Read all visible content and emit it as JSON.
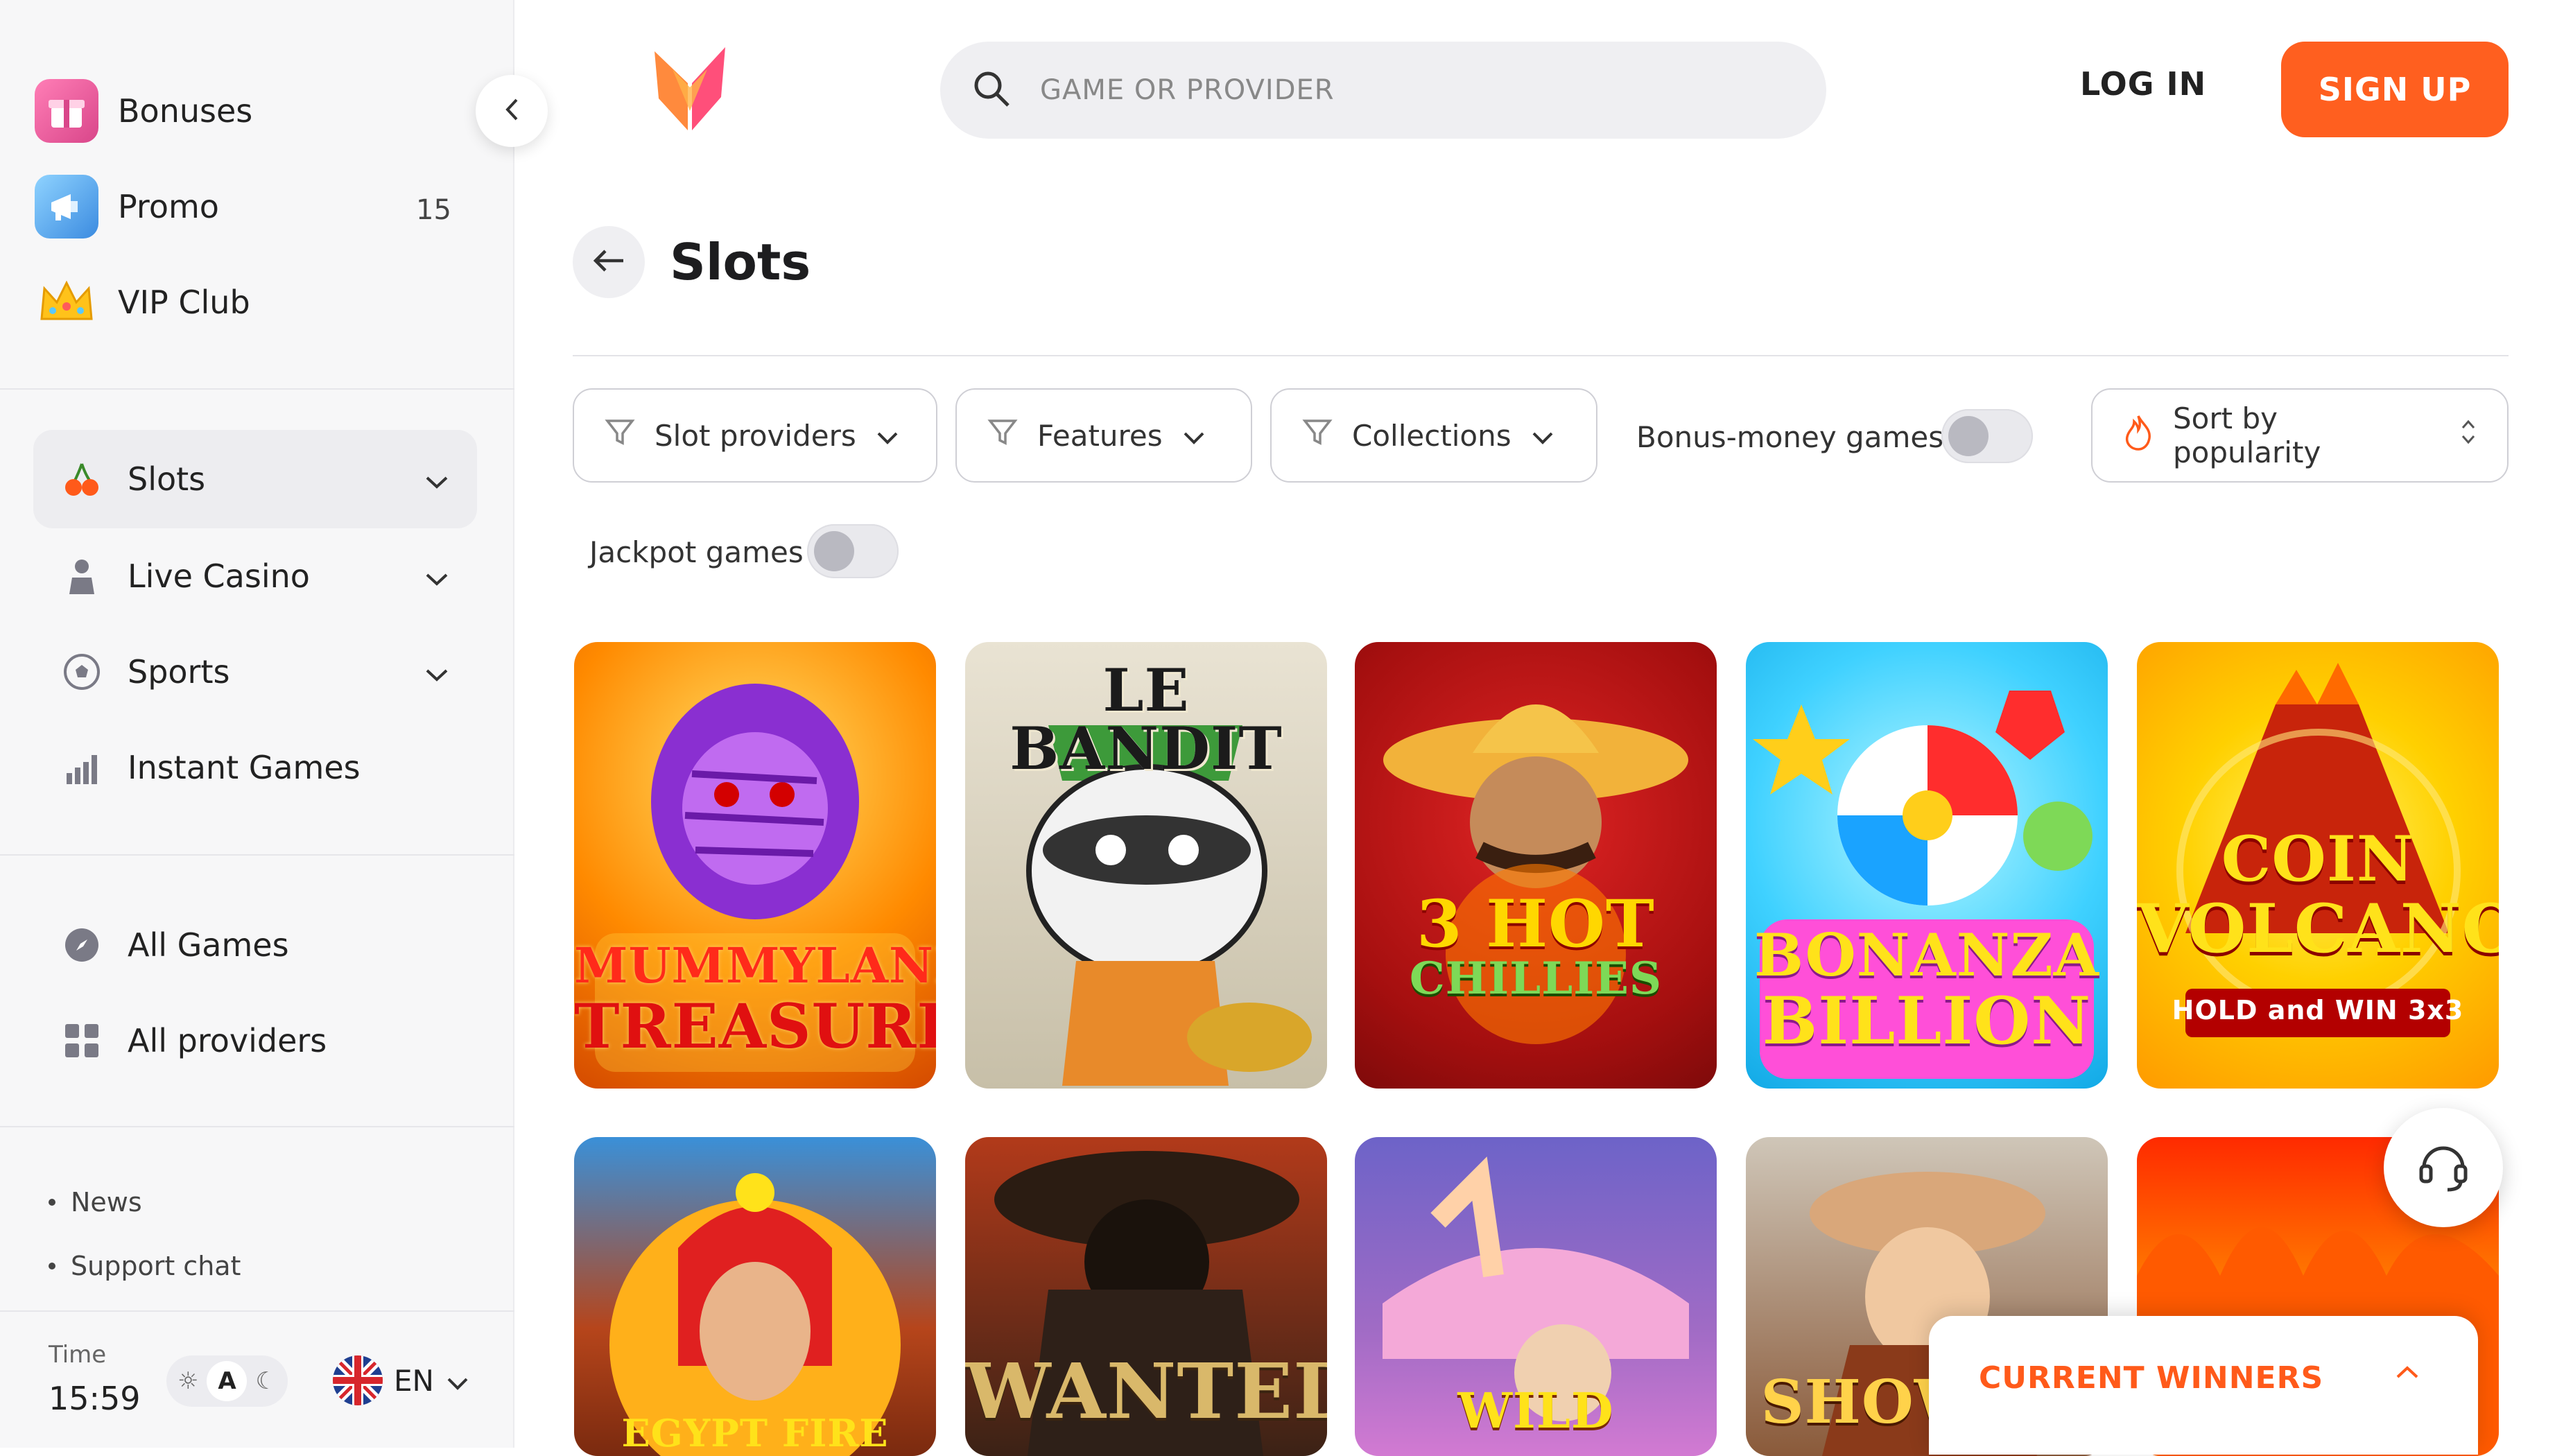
{
  "sidebar": {
    "promos": [
      {
        "label": "Bonuses",
        "icon": "gift-icon"
      },
      {
        "label": "Promo",
        "icon": "megaphone-icon",
        "count": "15"
      },
      {
        "label": "VIP Club",
        "icon": "crown-icon"
      }
    ],
    "nav": [
      {
        "label": "Slots",
        "icon": "cherries-icon",
        "active": true
      },
      {
        "label": "Live Casino",
        "icon": "dealer-icon"
      },
      {
        "label": "Sports",
        "icon": "soccer-ball-icon"
      },
      {
        "label": "Instant Games",
        "icon": "bar-chart-icon"
      }
    ],
    "catalog": [
      {
        "label": "All Games",
        "icon": "compass-icon"
      },
      {
        "label": "All providers",
        "icon": "grid-icon"
      }
    ],
    "links": [
      "News",
      "Support chat"
    ],
    "time_label": "Time",
    "time_value": "15:59",
    "theme": {
      "active": "A"
    },
    "language": "EN"
  },
  "header": {
    "search_placeholder": "GAME OR PROVIDER",
    "login_label": "LOG IN",
    "signup_label": "SIGN UP",
    "accent_color": "#ff5f1f"
  },
  "page": {
    "title": "Slots"
  },
  "filters": {
    "slot_providers": "Slot providers",
    "features": "Features",
    "collections": "Collections",
    "bonus_money_games": "Bonus-money games",
    "jackpot_games": "Jackpot games",
    "sort": "Sort by popularity"
  },
  "games": [
    {
      "line1": "MUMMYLAND",
      "line2": "TREASURES"
    },
    {
      "line1": "LE BANDIT",
      "line2": ""
    },
    {
      "line1": "3 HOT",
      "line2": "CHILLIES"
    },
    {
      "line1": "BONANZA",
      "line2": "BILLION"
    },
    {
      "line1": "COIN",
      "line2": "VOLCANO",
      "line3": "HOLD and WIN 3x3"
    },
    {
      "line1": "EGYPT FIRE"
    },
    {
      "line1": "WANTED"
    },
    {
      "line1": "WILD"
    },
    {
      "line1": "SHOW"
    },
    {
      "line1": ""
    }
  ],
  "winners": {
    "title": "CURRENT WINNERS"
  }
}
